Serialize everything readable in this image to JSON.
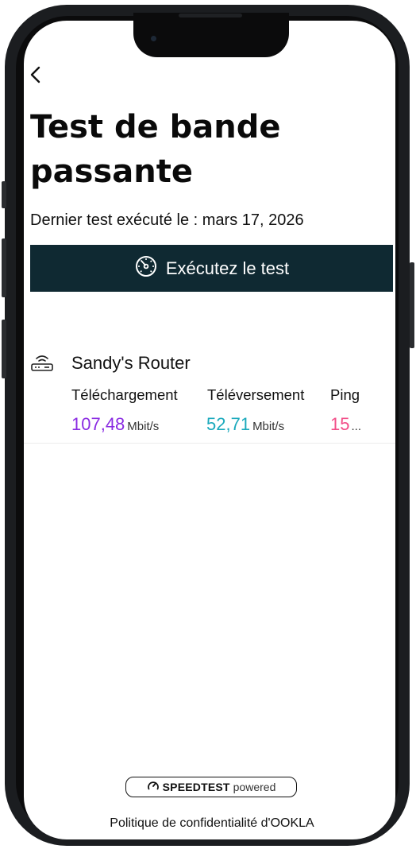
{
  "header": {
    "back_icon": "chevron-left-icon",
    "title": "Test de bande passante",
    "last_test": "Dernier test exécuté le : mars 17, 2026"
  },
  "run_button": {
    "icon": "speedometer-icon",
    "label": "Exécutez le test"
  },
  "router": {
    "icon": "router-icon",
    "name": "Sandy's Router",
    "labels": {
      "download": "Téléchargement",
      "upload": "Téléversement",
      "ping": "Ping"
    },
    "download": {
      "value": "107,48",
      "unit": "Mbit/s"
    },
    "upload": {
      "value": "52,71",
      "unit": "Mbit/s"
    },
    "ping": {
      "value": "15",
      "overflow": "..."
    }
  },
  "footer": {
    "speedtest_brand": "SPEEDTEST",
    "speedtest_suffix": "powered",
    "privacy_link": "Politique de confidentialité d'OOKLA"
  },
  "colors": {
    "button_bg": "#0f2932",
    "download": "#8a2be2",
    "upload": "#1aa9bc",
    "ping": "#f24e88"
  }
}
